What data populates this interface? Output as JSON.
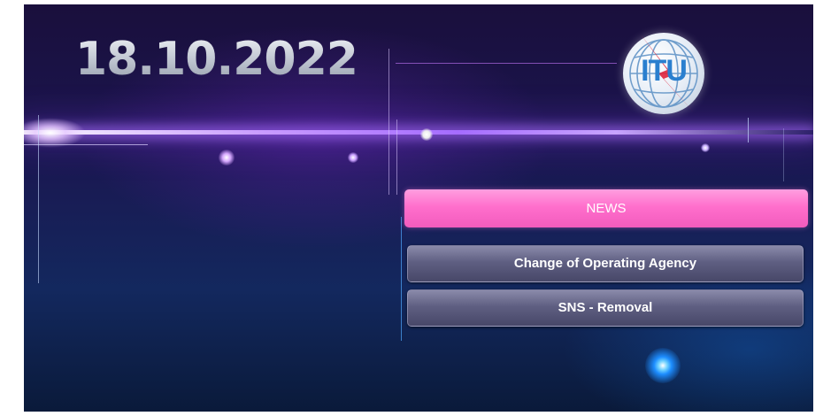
{
  "banner": {
    "date": "18.10.2022",
    "logo_text": "ITU"
  },
  "menu": {
    "news_label": "NEWS",
    "items": [
      {
        "label": "Change of Operating Agency"
      },
      {
        "label": "SNS - Removal"
      }
    ]
  },
  "colors": {
    "news_button": "#ff77cf",
    "menu_button": "#5f5f82",
    "beam": "#b07cff",
    "background": "#1b1650"
  }
}
